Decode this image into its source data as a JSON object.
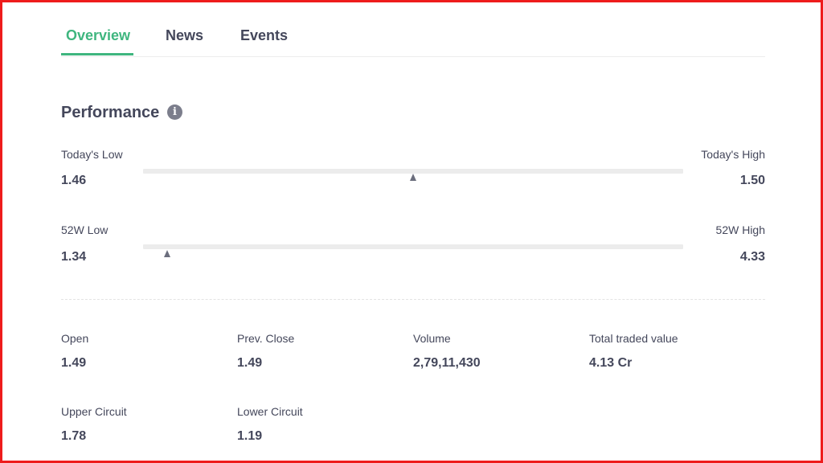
{
  "tabs": [
    {
      "label": "Overview",
      "active": true
    },
    {
      "label": "News",
      "active": false
    },
    {
      "label": "Events",
      "active": false
    }
  ],
  "performance": {
    "title": "Performance",
    "info_icon": "info-icon",
    "today": {
      "low_label": "Today's Low",
      "low_value": "1.46",
      "high_label": "Today's High",
      "high_value": "1.50",
      "current_fraction": 0.5
    },
    "week52": {
      "low_label": "52W Low",
      "low_value": "1.34",
      "high_label": "52W High",
      "high_value": "4.33",
      "current_fraction": 0.045
    }
  },
  "stats": [
    {
      "label": "Open",
      "value": "1.49"
    },
    {
      "label": "Prev. Close",
      "value": "1.49"
    },
    {
      "label": "Volume",
      "value": "2,79,11,430"
    },
    {
      "label": "Total traded value",
      "value": "4.13 Cr"
    },
    {
      "label": "Upper Circuit",
      "value": "1.78"
    },
    {
      "label": "Lower Circuit",
      "value": "1.19"
    }
  ],
  "colors": {
    "accent": "#3fb67f",
    "text": "#44475b",
    "border": "#ee1c1c"
  }
}
